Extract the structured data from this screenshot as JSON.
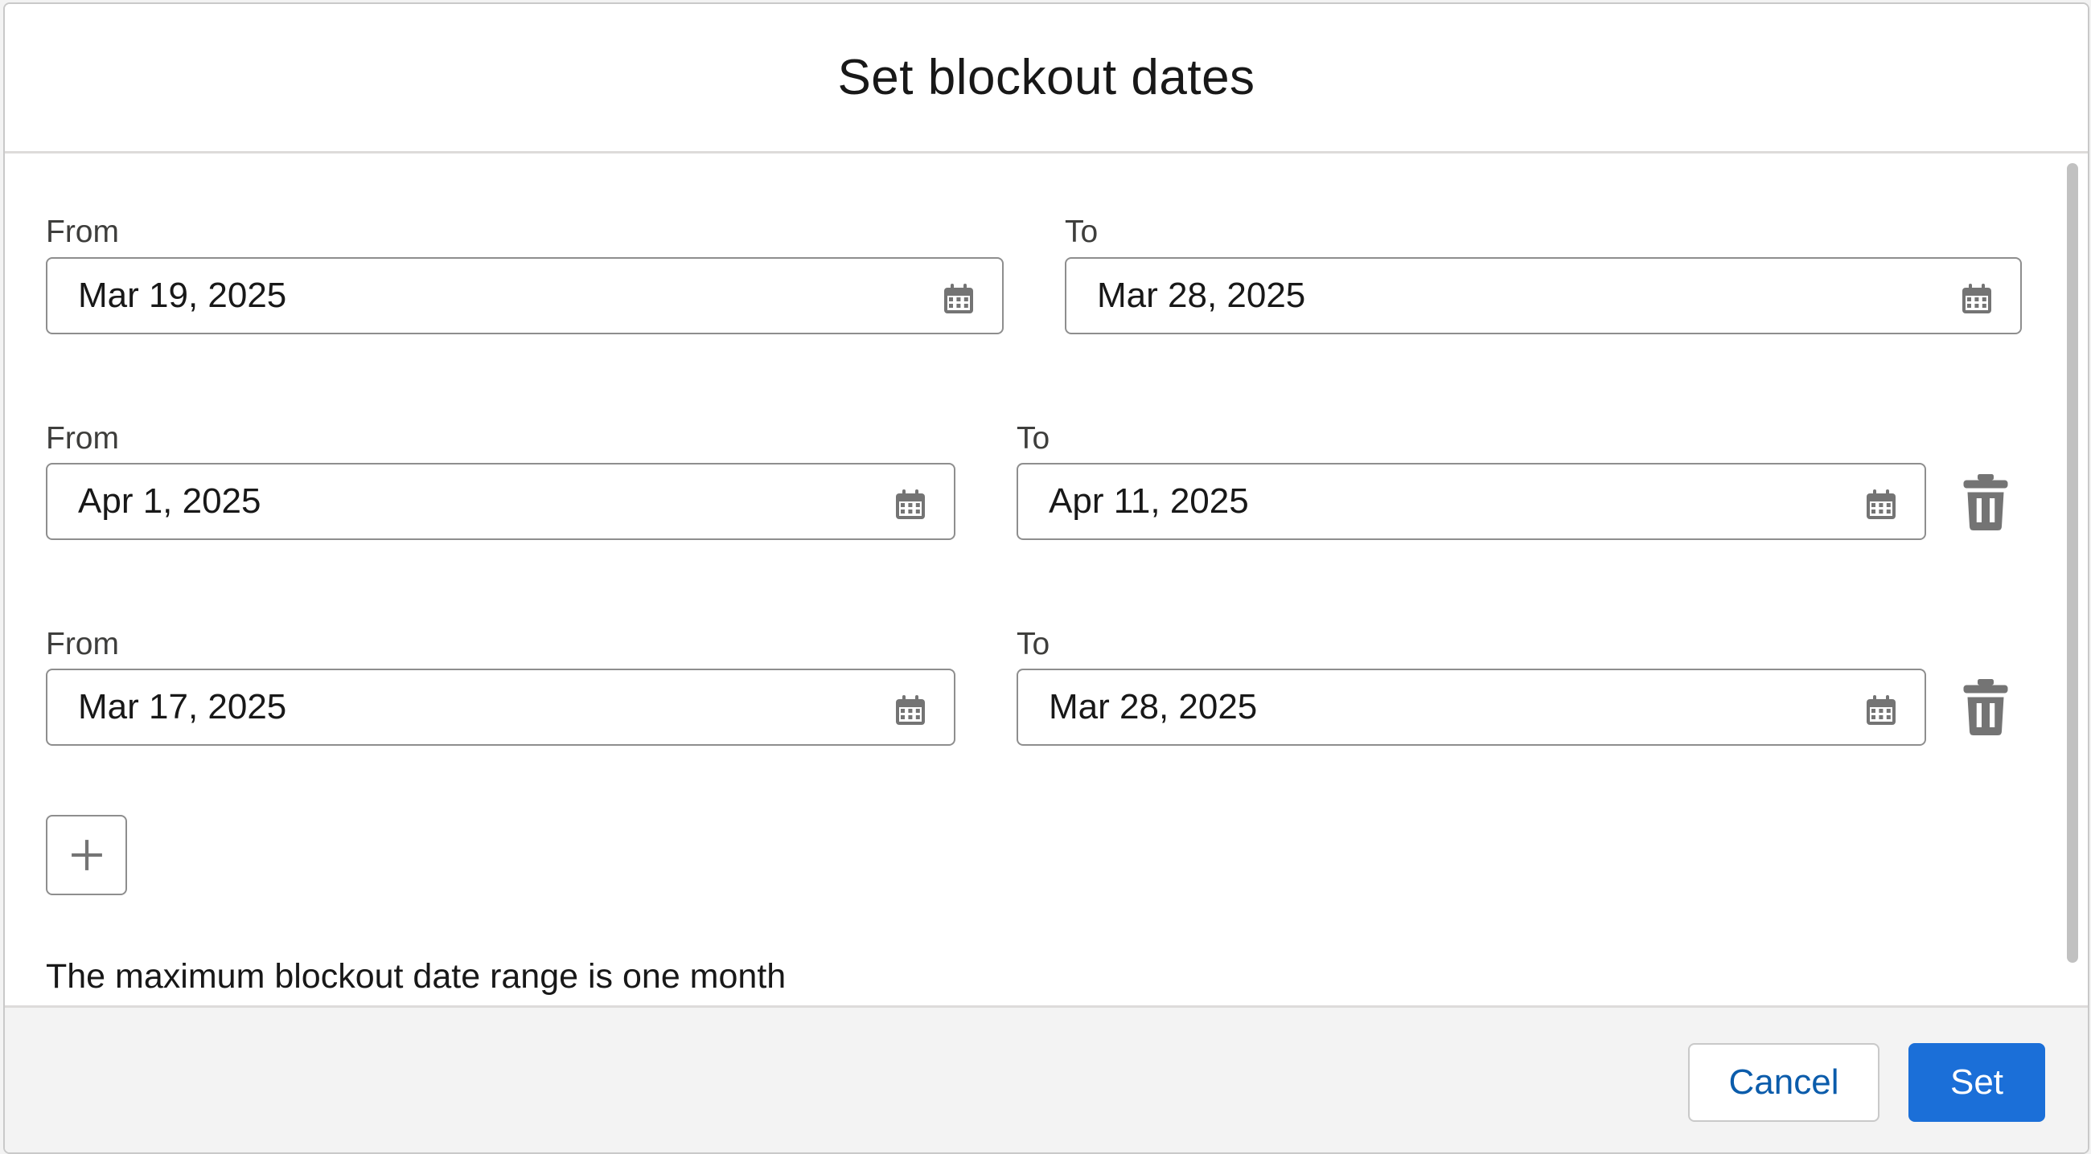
{
  "dialog": {
    "title": "Set blockout dates",
    "note": "The maximum blockout date range is one month"
  },
  "ranges": [
    {
      "from_label": "From",
      "from_value": "Mar 19, 2025",
      "to_label": "To",
      "to_value": "Mar 28, 2025",
      "deletable": false
    },
    {
      "from_label": "From",
      "from_value": "Apr 1, 2025",
      "to_label": "To",
      "to_value": "Apr 11, 2025",
      "deletable": true
    },
    {
      "from_label": "From",
      "from_value": "Mar 17, 2025",
      "to_label": "To",
      "to_value": "Mar 28, 2025",
      "deletable": true
    }
  ],
  "footer": {
    "cancel_label": "Cancel",
    "set_label": "Set"
  },
  "icons": {
    "calendar": "calendar-icon",
    "delete": "trash-icon",
    "add": "plus-icon"
  },
  "colors": {
    "primary": "#1b6fd8",
    "link": "#0b5cab",
    "icon": "#747474"
  }
}
